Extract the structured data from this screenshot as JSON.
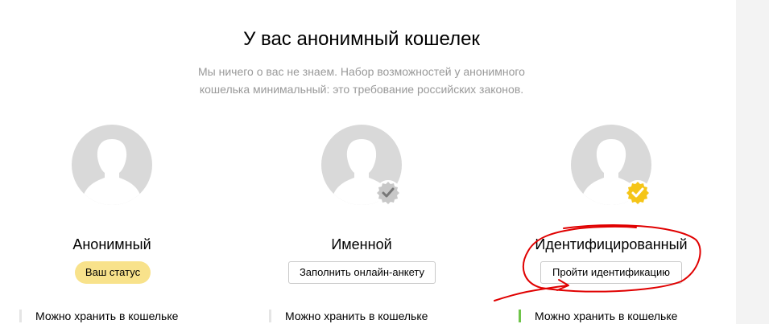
{
  "header": {
    "title": "У вас анонимный кошелек",
    "subtitle_line1": "Мы ничего о вас не знаем. Набор возможностей у анонимного",
    "subtitle_line2": "кошелька минимальный: это требование российских законов."
  },
  "statuses": [
    {
      "title": "Анонимный",
      "badge_label": "Ваш статус",
      "feature_label": "Можно хранить в кошельке"
    },
    {
      "title": "Именной",
      "button_label": "Заполнить онлайн-анкету",
      "feature_label": "Можно хранить в кошельке",
      "badge_icon": "gray-check-seal-icon"
    },
    {
      "title": "Идентифицированный",
      "button_label": "Пройти идентификацию",
      "feature_label": "Можно хранить в кошельке",
      "badge_icon": "yellow-check-seal-icon"
    }
  ],
  "colors": {
    "status_pill": "#f8e28b",
    "avatar_bg": "#d9d9d9",
    "feature_bar_active": "#6fc44a",
    "annotation": "#e00000"
  }
}
